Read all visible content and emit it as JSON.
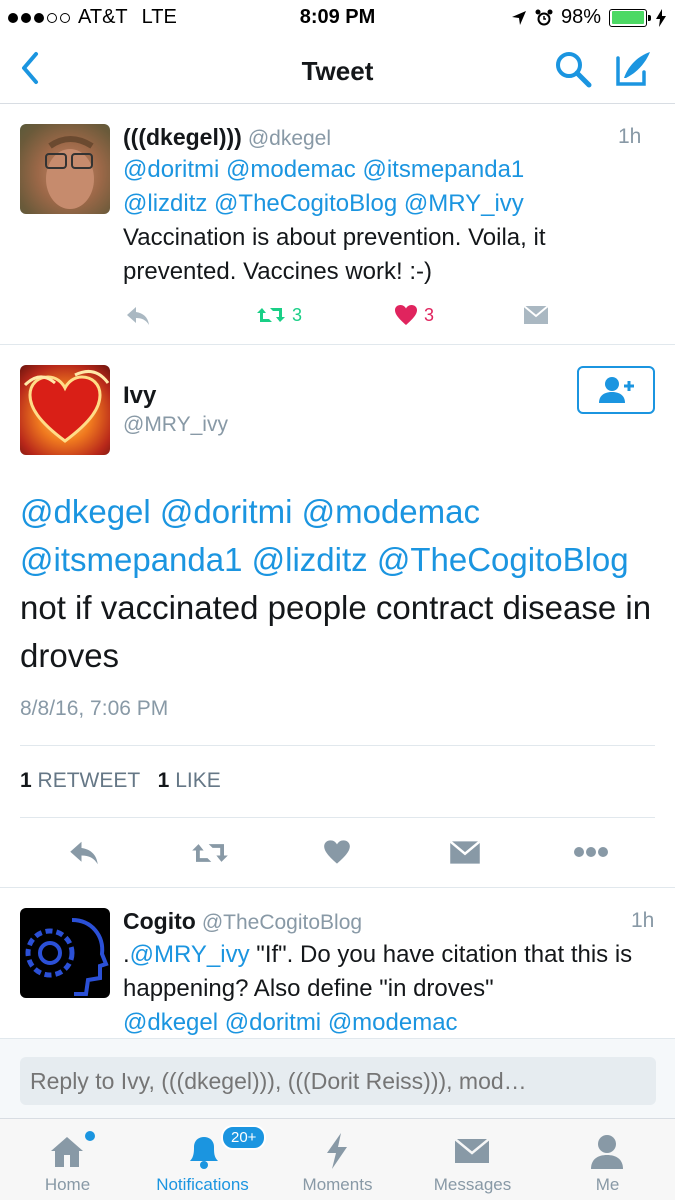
{
  "status_bar": {
    "carrier": "AT&T",
    "network": "LTE",
    "time": "8:09 PM",
    "battery": "98%",
    "battery_level": 0.98,
    "signal_bars": 3
  },
  "nav": {
    "title": "Tweet"
  },
  "tweet1": {
    "name": "(((dkegel)))",
    "handle": "@dkegel",
    "time": "1h",
    "mentions_line1": [
      "@doritmi",
      "@modemac",
      "@itsmepanda1"
    ],
    "mentions_line2": [
      "@lizditz",
      "@TheCogitoBlog",
      "@MRY_ivy"
    ],
    "text": "Vaccination is about prevention.  Voila, it prevented.  Vaccines work! :-)",
    "retweets": "3",
    "likes": "3"
  },
  "main_tweet": {
    "name": "Ivy",
    "handle": "@MRY_ivy",
    "mentions_line1": [
      "@dkegel",
      "@doritmi",
      "@modemac"
    ],
    "mentions_line2": [
      "@itsmepanda1",
      "@lizditz",
      "@TheCogitoBlog"
    ],
    "text": "not if vaccinated people contract disease in droves",
    "date": "8/8/16, 7:06 PM",
    "retweet_count": "1",
    "retweet_label": "RETWEET",
    "like_count": "1",
    "like_label": "LIKE"
  },
  "tweet3": {
    "name": "Cogito",
    "handle": "@TheCogitoBlog",
    "time": "1h",
    "prefix": ".",
    "mention_first": "@MRY_ivy",
    "text": " \"If\". Do you have citation that this is happening? Also define \"in droves\"",
    "mentions_trailing": [
      "@dkegel",
      "@doritmi",
      "@modemac"
    ]
  },
  "reply": {
    "placeholder": "Reply to Ivy, (((dkegel))), (((Dorit Reiss))), mod…"
  },
  "tabs": [
    {
      "label": "Home",
      "icon": "home-icon"
    },
    {
      "label": "Notifications",
      "icon": "bell-icon",
      "badge": "20+"
    },
    {
      "label": "Moments",
      "icon": "lightning-icon"
    },
    {
      "label": "Messages",
      "icon": "envelope-icon"
    },
    {
      "label": "Me",
      "icon": "person-icon"
    }
  ],
  "colors": {
    "accent": "#1b95e0",
    "retweet": "#19cf86",
    "like": "#e0245e",
    "muted": "#8899a6"
  }
}
